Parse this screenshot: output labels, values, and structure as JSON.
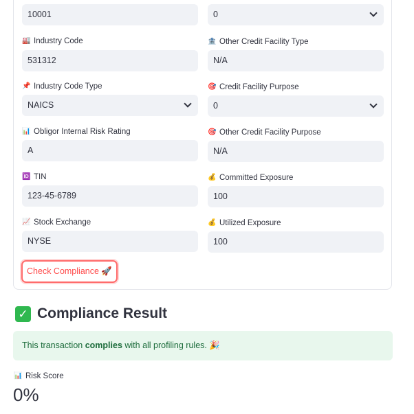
{
  "form": {
    "top_left_value": "10001",
    "top_right_value": "0",
    "fields": [
      {
        "label": "Industry Code",
        "icon": "🏭",
        "value": "531312"
      },
      {
        "label": "Other Credit Facility Type",
        "icon": "🏦",
        "value": "N/A"
      },
      {
        "label": "Industry Code Type",
        "icon": "📌",
        "value": "NAICS"
      },
      {
        "label": "Credit Facility Purpose",
        "icon": "🎯",
        "value": "0"
      },
      {
        "label": "Obligor Internal Risk Rating",
        "icon": "📊",
        "value": "A"
      },
      {
        "label": "Other Credit Facility Purpose",
        "icon": "🎯",
        "value": "N/A"
      },
      {
        "label": "TIN",
        "icon": "🆔",
        "value": "123-45-6789"
      },
      {
        "label": "Committed Exposure",
        "icon": "💰",
        "value": "100"
      },
      {
        "label": "Stock Exchange",
        "icon": "📈",
        "value": "NYSE"
      },
      {
        "label": "Utilized Exposure",
        "icon": "💰",
        "value": "100"
      }
    ],
    "button_label": "Check Compliance 🚀"
  },
  "result": {
    "check_icon": "✓",
    "title": "Compliance Result",
    "alert_pre": "This transaction ",
    "alert_bold": "complies",
    "alert_post": " with all profiling rules. 🎉"
  },
  "metric": {
    "icon": "📊",
    "label": "Risk Score",
    "value": "0%"
  }
}
